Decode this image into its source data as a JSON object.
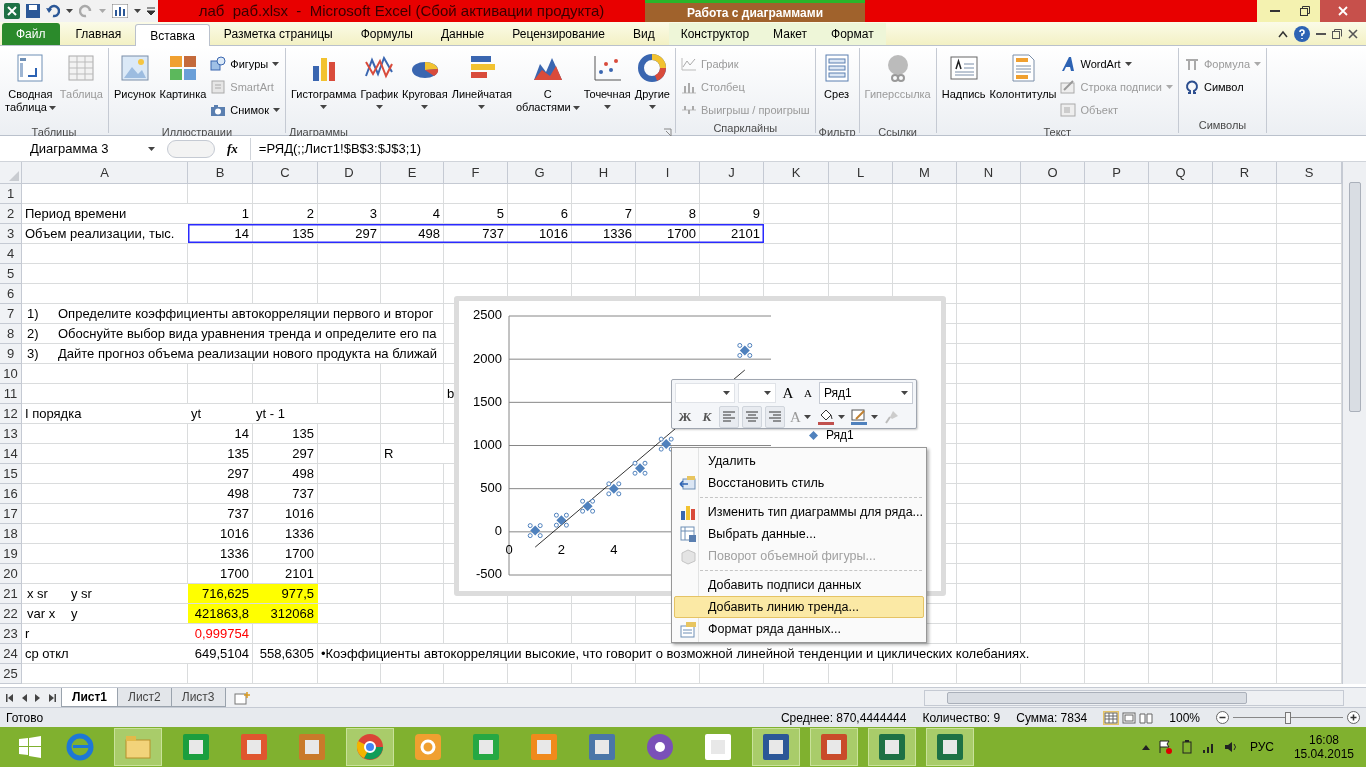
{
  "window": {
    "title": "лаб  раб.xlsx  -  Microsoft Excel (Сбой активации продукта)",
    "context_header": "Работа с диаграммами"
  },
  "ribbon_tabs": [
    {
      "label": "Файл",
      "kind": "file",
      "selected": false
    },
    {
      "label": "Главная",
      "kind": "normal",
      "selected": false
    },
    {
      "label": "Вставка",
      "kind": "normal",
      "selected": true
    },
    {
      "label": "Разметка страницы",
      "kind": "normal",
      "selected": false
    },
    {
      "label": "Формулы",
      "kind": "normal",
      "selected": false
    },
    {
      "label": "Данные",
      "kind": "normal",
      "selected": false
    },
    {
      "label": "Рецензирование",
      "kind": "normal",
      "selected": false
    },
    {
      "label": "Вид",
      "kind": "normal",
      "selected": false
    },
    {
      "label": "Конструктор",
      "kind": "contextual",
      "selected": false
    },
    {
      "label": "Макет",
      "kind": "contextual",
      "selected": false
    },
    {
      "label": "Формат",
      "kind": "contextual",
      "selected": false
    }
  ],
  "ribbon_groups": [
    {
      "label": "Таблицы",
      "launcher": false,
      "items": [
        {
          "kind": "large",
          "lines": [
            "Сводная",
            "таблица"
          ],
          "dropdown": true,
          "disabled": false
        },
        {
          "kind": "large",
          "lines": [
            "Таблица"
          ],
          "dropdown": false,
          "disabled": true
        }
      ]
    },
    {
      "label": "Иллюстрации",
      "launcher": false,
      "items": [
        {
          "kind": "large",
          "lines": [
            "Рисунок"
          ],
          "dropdown": false,
          "disabled": false
        },
        {
          "kind": "large",
          "lines": [
            "Картинка"
          ],
          "dropdown": false,
          "disabled": false
        },
        {
          "kind": "small",
          "lines": [
            "Фигуры"
          ],
          "dropdown": true,
          "disabled": false
        },
        {
          "kind": "small",
          "lines": [
            "SmartArt"
          ],
          "dropdown": false,
          "disabled": true
        },
        {
          "kind": "small",
          "lines": [
            "Снимок"
          ],
          "dropdown": true,
          "disabled": false
        }
      ]
    },
    {
      "label": "Диаграммы",
      "launcher": true,
      "items": [
        {
          "kind": "large",
          "lines": [
            "Гистограмма"
          ],
          "dropdown": true,
          "disabled": false
        },
        {
          "kind": "large",
          "lines": [
            "График"
          ],
          "dropdown": true,
          "disabled": false
        },
        {
          "kind": "large",
          "lines": [
            "Круговая"
          ],
          "dropdown": true,
          "disabled": false
        },
        {
          "kind": "large",
          "lines": [
            "Линейчатая"
          ],
          "dropdown": true,
          "disabled": false
        },
        {
          "kind": "large",
          "lines": [
            "С",
            "областями"
          ],
          "dropdown": true,
          "disabled": false
        },
        {
          "kind": "large",
          "lines": [
            "Точечная"
          ],
          "dropdown": true,
          "disabled": false
        },
        {
          "kind": "large",
          "lines": [
            "Другие"
          ],
          "dropdown": true,
          "disabled": false
        }
      ]
    },
    {
      "label": "Спарклайны",
      "launcher": false,
      "items": [
        {
          "kind": "small",
          "lines": [
            "График"
          ],
          "dropdown": false,
          "disabled": true
        },
        {
          "kind": "small",
          "lines": [
            "Столбец"
          ],
          "dropdown": false,
          "disabled": true
        },
        {
          "kind": "small",
          "lines": [
            "Выигрыш / проигрыш"
          ],
          "dropdown": false,
          "disabled": true
        }
      ]
    },
    {
      "label": "Фильтр",
      "launcher": false,
      "items": [
        {
          "kind": "large",
          "lines": [
            "Срез"
          ],
          "dropdown": false,
          "disabled": false
        }
      ]
    },
    {
      "label": "Ссылки",
      "launcher": false,
      "items": [
        {
          "kind": "large",
          "lines": [
            "Гиперссылка"
          ],
          "dropdown": false,
          "disabled": true
        }
      ]
    },
    {
      "label": "Текст",
      "launcher": false,
      "items": [
        {
          "kind": "large",
          "lines": [
            "Надпись"
          ],
          "dropdown": false,
          "disabled": false
        },
        {
          "kind": "large",
          "lines": [
            "Колонтитулы"
          ],
          "dropdown": false,
          "disabled": false
        },
        {
          "kind": "small",
          "lines": [
            "WordArt"
          ],
          "dropdown": true,
          "disabled": false
        },
        {
          "kind": "small",
          "lines": [
            "Строка подписи"
          ],
          "dropdown": true,
          "disabled": true
        },
        {
          "kind": "small",
          "lines": [
            "Объект"
          ],
          "dropdown": false,
          "disabled": true
        }
      ]
    },
    {
      "label": "Символы",
      "launcher": false,
      "items": [
        {
          "kind": "small",
          "lines": [
            "Формула"
          ],
          "dropdown": true,
          "disabled": true
        },
        {
          "kind": "small",
          "lines": [
            "Символ"
          ],
          "dropdown": false,
          "disabled": false
        }
      ]
    }
  ],
  "formula_bar": {
    "name_box": "Диаграмма 3",
    "fx": "fx",
    "formula": "=РЯД(;;Лист1!$B$3:$J$3;1)"
  },
  "sheet": {
    "columns": [
      "A",
      "B",
      "C",
      "D",
      "E",
      "F",
      "G",
      "H",
      "I",
      "J",
      "K",
      "L",
      "M",
      "N",
      "O",
      "P",
      "Q",
      "R",
      "S"
    ],
    "rows": [
      {
        "number": "1"
      },
      {
        "number": "2",
        "cells": [
          {
            "kind": "text",
            "text": "Период времени"
          },
          {
            "kind": "number",
            "text": "1"
          },
          {
            "kind": "number",
            "text": "2"
          },
          {
            "kind": "number",
            "text": "3"
          },
          {
            "kind": "number",
            "text": "4"
          },
          {
            "kind": "number",
            "text": "5"
          },
          {
            "kind": "number",
            "text": "6"
          },
          {
            "kind": "number",
            "text": "7"
          },
          {
            "kind": "number",
            "text": "8"
          },
          {
            "kind": "number",
            "text": "9"
          }
        ]
      },
      {
        "number": "3",
        "outlined": true,
        "cells": [
          {
            "kind": "text",
            "text": "Объем реализации, тыс."
          },
          {
            "kind": "number",
            "text": "14"
          },
          {
            "kind": "number",
            "text": "135"
          },
          {
            "kind": "number",
            "text": "297"
          },
          {
            "kind": "number",
            "text": "498"
          },
          {
            "kind": "number",
            "text": "737"
          },
          {
            "kind": "number",
            "text": "1016"
          },
          {
            "kind": "number",
            "text": "1336"
          },
          {
            "kind": "number",
            "text": "1700"
          },
          {
            "kind": "number",
            "text": "2101"
          }
        ]
      },
      {
        "number": "4"
      },
      {
        "number": "5"
      },
      {
        "number": "6"
      },
      {
        "number": "7",
        "cells": [
          {
            "kind": "item",
            "marker": "1)",
            "text": "Определите коэффициенты автокорреляции первого и второг"
          }
        ]
      },
      {
        "number": "8",
        "cells": [
          {
            "kind": "item",
            "marker": "2)",
            "text": "Обоснуйте выбор вида уравнения тренда и определите его па"
          }
        ]
      },
      {
        "number": "9",
        "cells": [
          {
            "kind": "item",
            "marker": "3)",
            "text": "Дайте прогноз объема реализации нового продукта на ближай"
          }
        ]
      },
      {
        "number": "10"
      },
      {
        "number": "11",
        "cells": [
          null,
          null,
          null,
          null,
          null,
          {
            "kind": "text",
            "text": "b"
          }
        ]
      },
      {
        "number": "12",
        "cells": [
          {
            "kind": "text",
            "text": "I порядка"
          },
          {
            "kind": "text",
            "text": "yt"
          },
          {
            "kind": "text",
            "text": "yt - 1"
          }
        ]
      },
      {
        "number": "13",
        "cells": [
          null,
          {
            "kind": "number",
            "text": "14"
          },
          {
            "kind": "number",
            "text": "135"
          }
        ]
      },
      {
        "number": "14",
        "cells": [
          null,
          {
            "kind": "number",
            "text": "135"
          },
          {
            "kind": "number",
            "text": "297"
          },
          null,
          {
            "kind": "text",
            "text": "R"
          }
        ]
      },
      {
        "number": "15",
        "cells": [
          null,
          {
            "kind": "number",
            "text": "297"
          },
          {
            "kind": "number",
            "text": "498"
          }
        ]
      },
      {
        "number": "16",
        "cells": [
          null,
          {
            "kind": "number",
            "text": "498"
          },
          {
            "kind": "number",
            "text": "737"
          }
        ]
      },
      {
        "number": "17",
        "cells": [
          null,
          {
            "kind": "number",
            "text": "737"
          },
          {
            "kind": "number",
            "text": "1016"
          }
        ]
      },
      {
        "number": "18",
        "cells": [
          null,
          {
            "kind": "number",
            "text": "1016"
          },
          {
            "kind": "number",
            "text": "1336"
          }
        ]
      },
      {
        "number": "19",
        "cells": [
          null,
          {
            "kind": "number",
            "text": "1336"
          },
          {
            "kind": "number",
            "text": "1700"
          }
        ]
      },
      {
        "number": "20",
        "cells": [
          null,
          {
            "kind": "number",
            "text": "1700"
          },
          {
            "kind": "number",
            "text": "2101"
          }
        ]
      },
      {
        "number": "21",
        "cells": [
          {
            "kind": "split",
            "parts": [
              "x sr",
              "y sr"
            ]
          },
          {
            "kind": "highlight",
            "text": "716,625"
          },
          {
            "kind": "highlight",
            "text": "977,5"
          }
        ]
      },
      {
        "number": "22",
        "cells": [
          {
            "kind": "split",
            "parts": [
              "var x",
              "y"
            ]
          },
          {
            "kind": "highlight",
            "text": "421863,8"
          },
          {
            "kind": "highlight",
            "text": "312068"
          }
        ]
      },
      {
        "number": "23",
        "cells": [
          {
            "kind": "text",
            "text": "r"
          },
          {
            "kind": "alert",
            "text": "0,999754"
          }
        ]
      },
      {
        "number": "24",
        "cells": [
          {
            "kind": "text",
            "text": "ср откл"
          },
          {
            "kind": "number",
            "text": "649,5104"
          },
          {
            "kind": "number",
            "text": "558,6305"
          },
          {
            "kind": "text",
            "text": "•Коэффициенты автокорреляции высокие, что говорит о возможной линейной тенденции и циклических колебаниях."
          }
        ]
      },
      {
        "number": "25"
      }
    ]
  },
  "chart": {
    "series_selected": true,
    "chart_data": {
      "type": "scatter",
      "x": [
        1,
        2,
        3,
        4,
        5,
        6,
        9
      ],
      "grid": true,
      "series": [
        {
          "name": "Ряд1",
          "color": "#4f81bd",
          "values": [
            14,
            135,
            297,
            498,
            737,
            1016,
            2101
          ]
        },
        {
          "type": "line",
          "color": "#000000",
          "values": [
            -177,
            79,
            336,
            592,
            848,
            1105,
            1874
          ]
        }
      ],
      "xlim": [
        0,
        10
      ],
      "ylim": [
        -500,
        2500
      ],
      "xticks": [
        0,
        2,
        4
      ],
      "yticks": [
        -500,
        0,
        500,
        1000,
        1500,
        2000,
        2500
      ]
    }
  },
  "mini_toolbar": {
    "grow_font": "A",
    "shrink_font": "A",
    "series_field": "Ряд1",
    "bold": "Ж",
    "italic": "К",
    "font_color": "A"
  },
  "context_menu": [
    {
      "kind": "item",
      "label": "Удалить",
      "selected": false,
      "disabled": false
    },
    {
      "kind": "item",
      "label": "Восстановить стиль",
      "selected": false,
      "disabled": false
    },
    {
      "kind": "separator"
    },
    {
      "kind": "item",
      "label": "Изменить тип диаграммы для ряда...",
      "selected": false,
      "disabled": false
    },
    {
      "kind": "item",
      "label": "Выбрать данные...",
      "selected": false,
      "disabled": false
    },
    {
      "kind": "item",
      "label": "Поворот объемной фигуры...",
      "selected": false,
      "disabled": true
    },
    {
      "kind": "separator"
    },
    {
      "kind": "item",
      "label": "Добавить подписи данных",
      "selected": false,
      "disabled": false
    },
    {
      "kind": "item",
      "label": "Добавить линию тренда...",
      "selected": true,
      "disabled": false
    },
    {
      "kind": "item",
      "label": "Формат ряда данных...",
      "selected": false,
      "disabled": false
    }
  ],
  "sheet_tabs": [
    {
      "label": "Лист1",
      "selected": true
    },
    {
      "label": "Лист2",
      "selected": false
    },
    {
      "label": "Лист3",
      "selected": false
    }
  ],
  "status_bar": {
    "state": "Готово",
    "average": "Среднее: 870,4444444",
    "count": "Количество: 9",
    "sum": "Сумма: 7834",
    "zoom": "100%",
    "zoom_slider": {
      "level": 0.5
    }
  },
  "taskbar": {
    "apps": [
      {
        "running": false
      },
      {
        "running": true
      },
      {
        "running": false
      },
      {
        "running": false
      },
      {
        "running": false
      },
      {
        "running": true
      },
      {
        "running": false
      },
      {
        "running": false
      },
      {
        "running": false
      },
      {
        "running": false
      },
      {
        "running": false
      },
      {
        "running": false
      },
      {
        "running": true
      },
      {
        "running": true
      },
      {
        "running": true
      },
      {
        "running": true
      }
    ],
    "language": "РУС",
    "time": "16:08",
    "date": "15.04.2015"
  }
}
